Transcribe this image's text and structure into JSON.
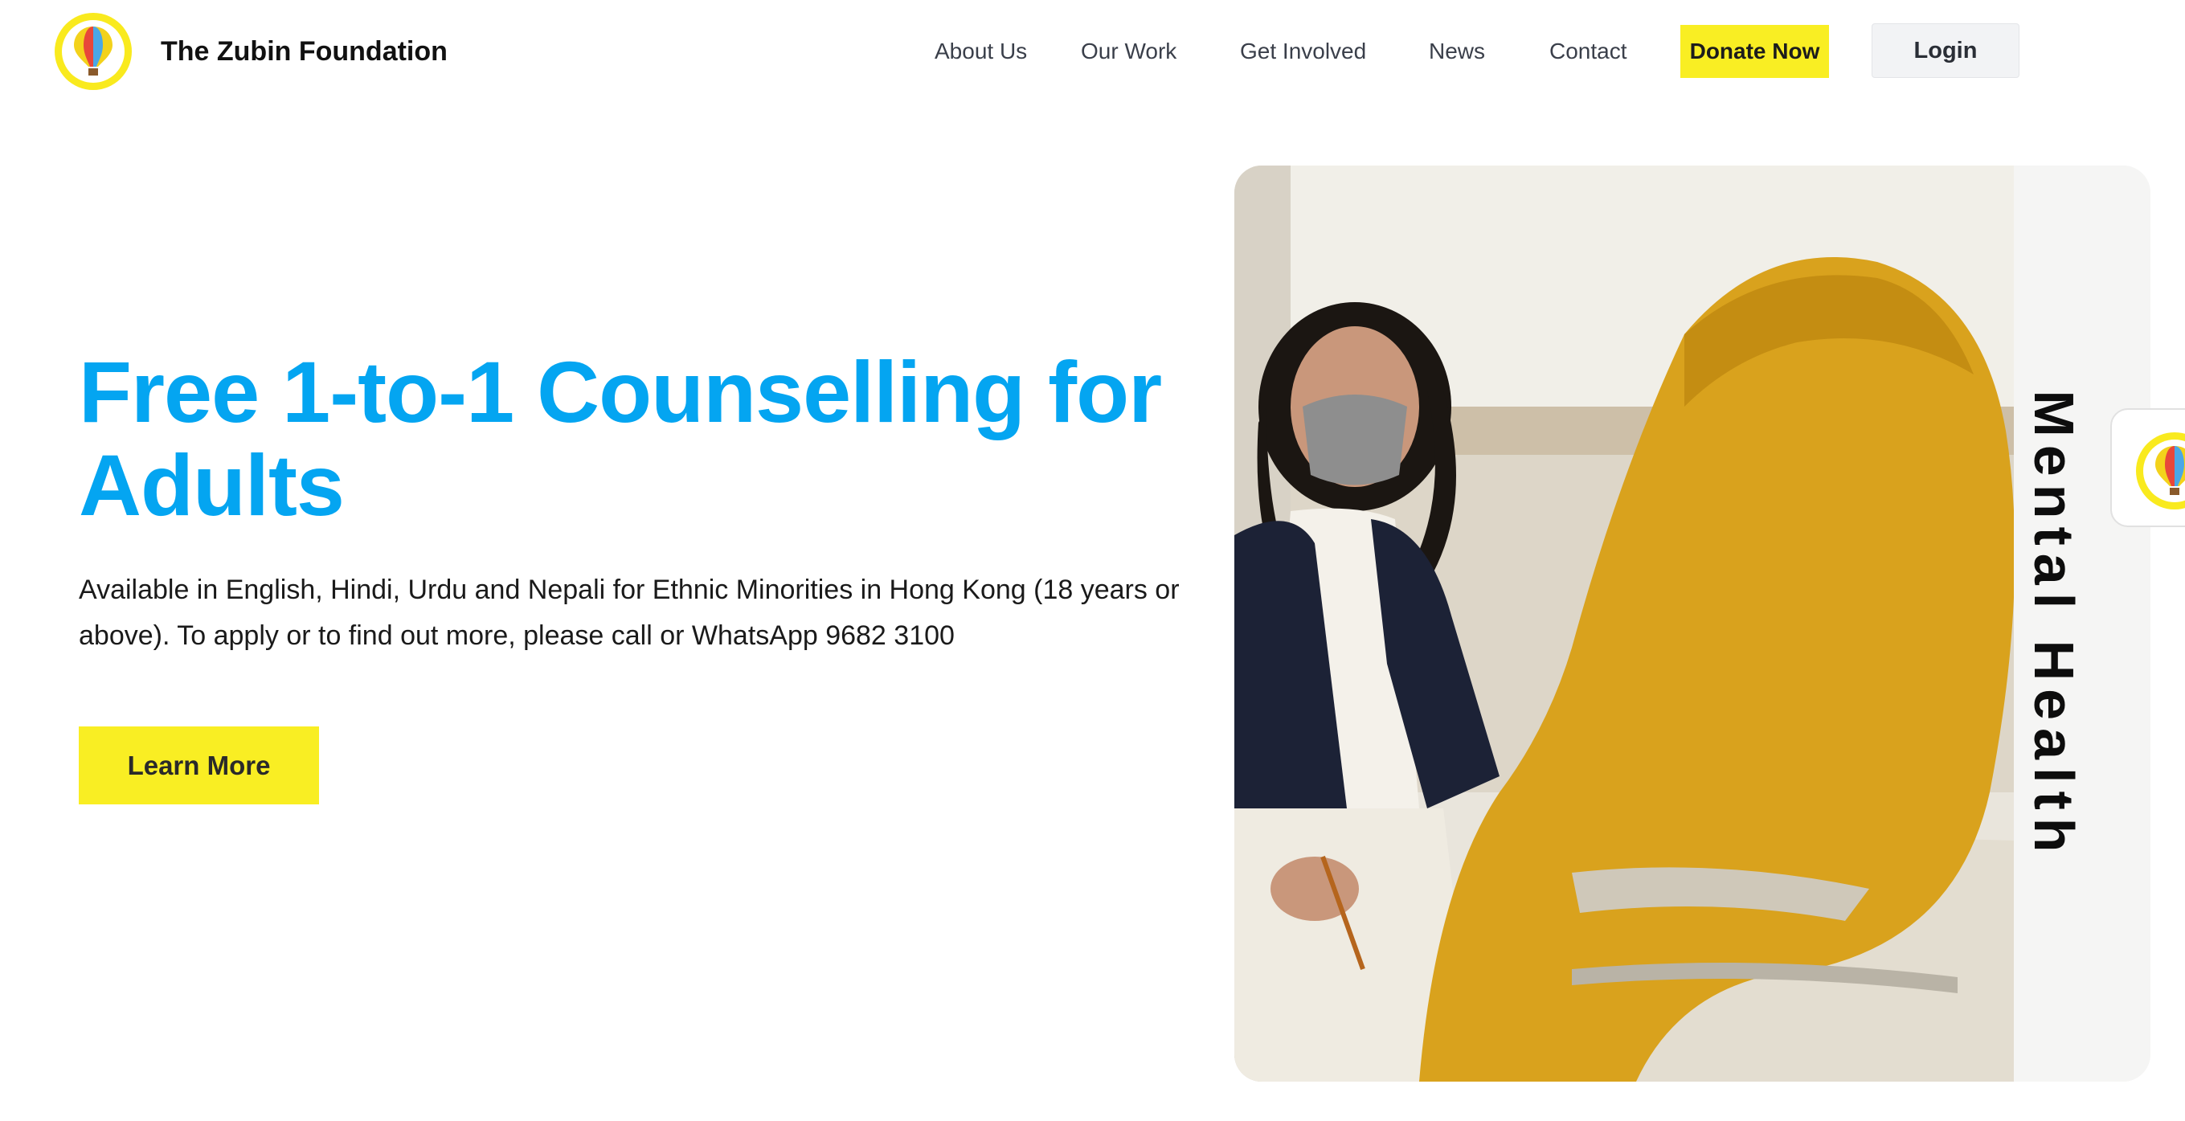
{
  "header": {
    "brand": "The Zubin Foundation",
    "logo_icon": "hot-air-balloon-logo-icon",
    "nav": [
      {
        "label": "About Us"
      },
      {
        "label": "Our Work"
      },
      {
        "label": "Get Involved"
      },
      {
        "label": "News"
      },
      {
        "label": "Contact"
      }
    ],
    "donate_label": "Donate Now",
    "login_label": "Login"
  },
  "hero": {
    "title": "Free 1-to-1 Counselling for Adults",
    "description": "Available in English, Hindi, Urdu and Nepali for Ethnic Minorities in Hong Kong (18 years or above). To apply or to find out more, please call or WhatsApp 9682 3100",
    "cta_label": "Learn More",
    "side_label": "Mental Health"
  },
  "colors": {
    "accent_blue": "#04a5f1",
    "brand_yellow": "#f9ee23",
    "headscarf_mustard": "#d9a21d"
  }
}
